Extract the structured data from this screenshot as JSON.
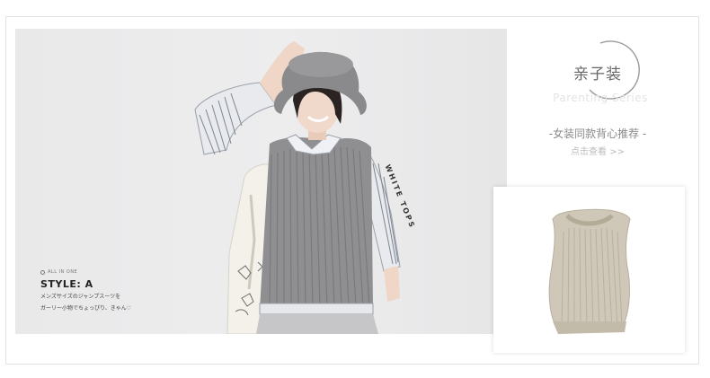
{
  "hero": {
    "tag": "ALL IN ONE",
    "style_title": "STYLE: A",
    "style_text_1": "メンズサイズのジャンプスーツを",
    "style_text_2": "ガーリー小物でちょっぴり、きゃん♡",
    "side_text": "WHITE TOPS"
  },
  "promo": {
    "title": "亲子装",
    "subtitle": "Parenting Series",
    "headline": "-女装同款背心推荐 -",
    "link": "点击查看 >>"
  },
  "colors": {
    "sweater": "#8f8f91",
    "vest": "#cfc8b8",
    "hat": "#8a8a8c",
    "pants": "#c6c6c8",
    "frame": "#e2e2e2"
  }
}
